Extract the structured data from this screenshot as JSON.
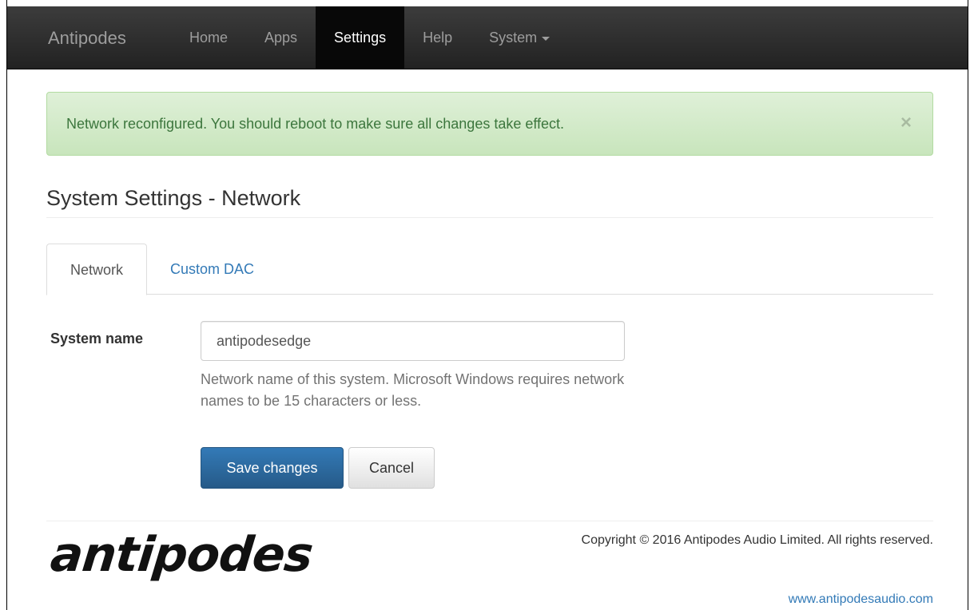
{
  "navbar": {
    "brand": "Antipodes",
    "items": [
      {
        "label": "Home"
      },
      {
        "label": "Apps"
      },
      {
        "label": "Settings"
      },
      {
        "label": "Help"
      },
      {
        "label": "System"
      }
    ]
  },
  "alert": {
    "message": "Network reconfigured. You should reboot to make sure all changes take effect.",
    "close": "×"
  },
  "page": {
    "title": "System Settings - Network"
  },
  "tabs": [
    {
      "label": "Network"
    },
    {
      "label": "Custom DAC"
    }
  ],
  "form": {
    "system_name_label": "System name",
    "system_name_value": "antipodesedge",
    "help_text": "Network name of this system. Microsoft Windows requires network names to be 15 characters or less.",
    "save_label": "Save changes",
    "cancel_label": "Cancel"
  },
  "footer": {
    "logo": "antipodes",
    "copyright": "Copyright © 2016 Antipodes Audio Limited. All rights reserved.",
    "website": "www.antipodesaudio.com"
  },
  "colors": {
    "navbar_bg": "#222222",
    "alert_bg": "#dff0d8",
    "alert_text": "#3c763d",
    "primary": "#337ab7",
    "link": "#337ab7"
  }
}
